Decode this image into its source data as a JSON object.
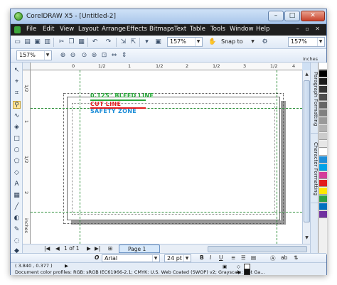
{
  "window": {
    "title": "CorelDRAW X5 - [Untitled-2]",
    "controls": {
      "minimize": "–",
      "maximize": "□",
      "close": "✕"
    }
  },
  "menu": {
    "items": [
      "File",
      "Edit",
      "View",
      "Layout",
      "Arrange",
      "Effects",
      "Bitmaps",
      "Text",
      "Table",
      "Tools",
      "Window",
      "Help"
    ],
    "right_controls": "– ▫ ✕"
  },
  "standard_toolbar": {
    "icons": [
      "new-icon",
      "open-icon",
      "save-icon",
      "print-icon",
      "cut-icon",
      "copy-icon",
      "paste-icon",
      "undo-icon",
      "redo-icon",
      "import-icon",
      "export-icon",
      "application-launcher-icon",
      "welcome-icon"
    ],
    "zoom_value": "157%",
    "snap_to_label": "Snap to",
    "right_zoom_value": "157%"
  },
  "property_bar": {
    "zoom_value": "157%",
    "icons": [
      "zoom-in-icon",
      "zoom-out-icon",
      "zoom-selected-icon",
      "zoom-all-icon",
      "zoom-page-icon",
      "zoom-width-icon",
      "zoom-height-icon"
    ]
  },
  "rulers": {
    "h_ticks": [
      "0",
      "1/2",
      "1",
      "1/2",
      "2",
      "1/2",
      "3",
      "1/2",
      "4"
    ],
    "units": "inches",
    "v_ticks": [
      "1/2",
      "1",
      "1/2",
      "2"
    ],
    "v_units": "inches"
  },
  "canvas": {
    "labels": {
      "bleed": "0.125\" BLEED LINE",
      "cut": "CUT LINE",
      "safe": "SAFETY ZONE"
    }
  },
  "dockers": {
    "tabs": [
      "Paragraph Formatting",
      "Character Formatting"
    ]
  },
  "palette": {
    "colors": [
      "#ffffff",
      "#000000",
      "#1a1a1a",
      "#333333",
      "#4d4d4d",
      "#666666",
      "#808080",
      "#999999",
      "#b3b3b3",
      "#cccccc",
      "#e6e6e6",
      "#ffffff",
      "#1e8ed8",
      "#00a2e8",
      "#d43c9a",
      "#e21b1b",
      "#ffe600",
      "#2ea043",
      "#0070c0",
      "#7030a0"
    ]
  },
  "page_nav": {
    "counter": "1 of 1",
    "page_tab": "Page 1"
  },
  "text_bar": {
    "font": "Arial",
    "size": "24 pt",
    "bold": "B",
    "italic": "I",
    "underline": "U"
  },
  "status": {
    "coords": "( 3.840 , 0.377 )",
    "profiles": "Document color profiles: RGB: sRGB IEC61966-2.1; CMYK: U.S. Web Coated (SWOP) v2; Grayscale: Dot Ga..."
  }
}
